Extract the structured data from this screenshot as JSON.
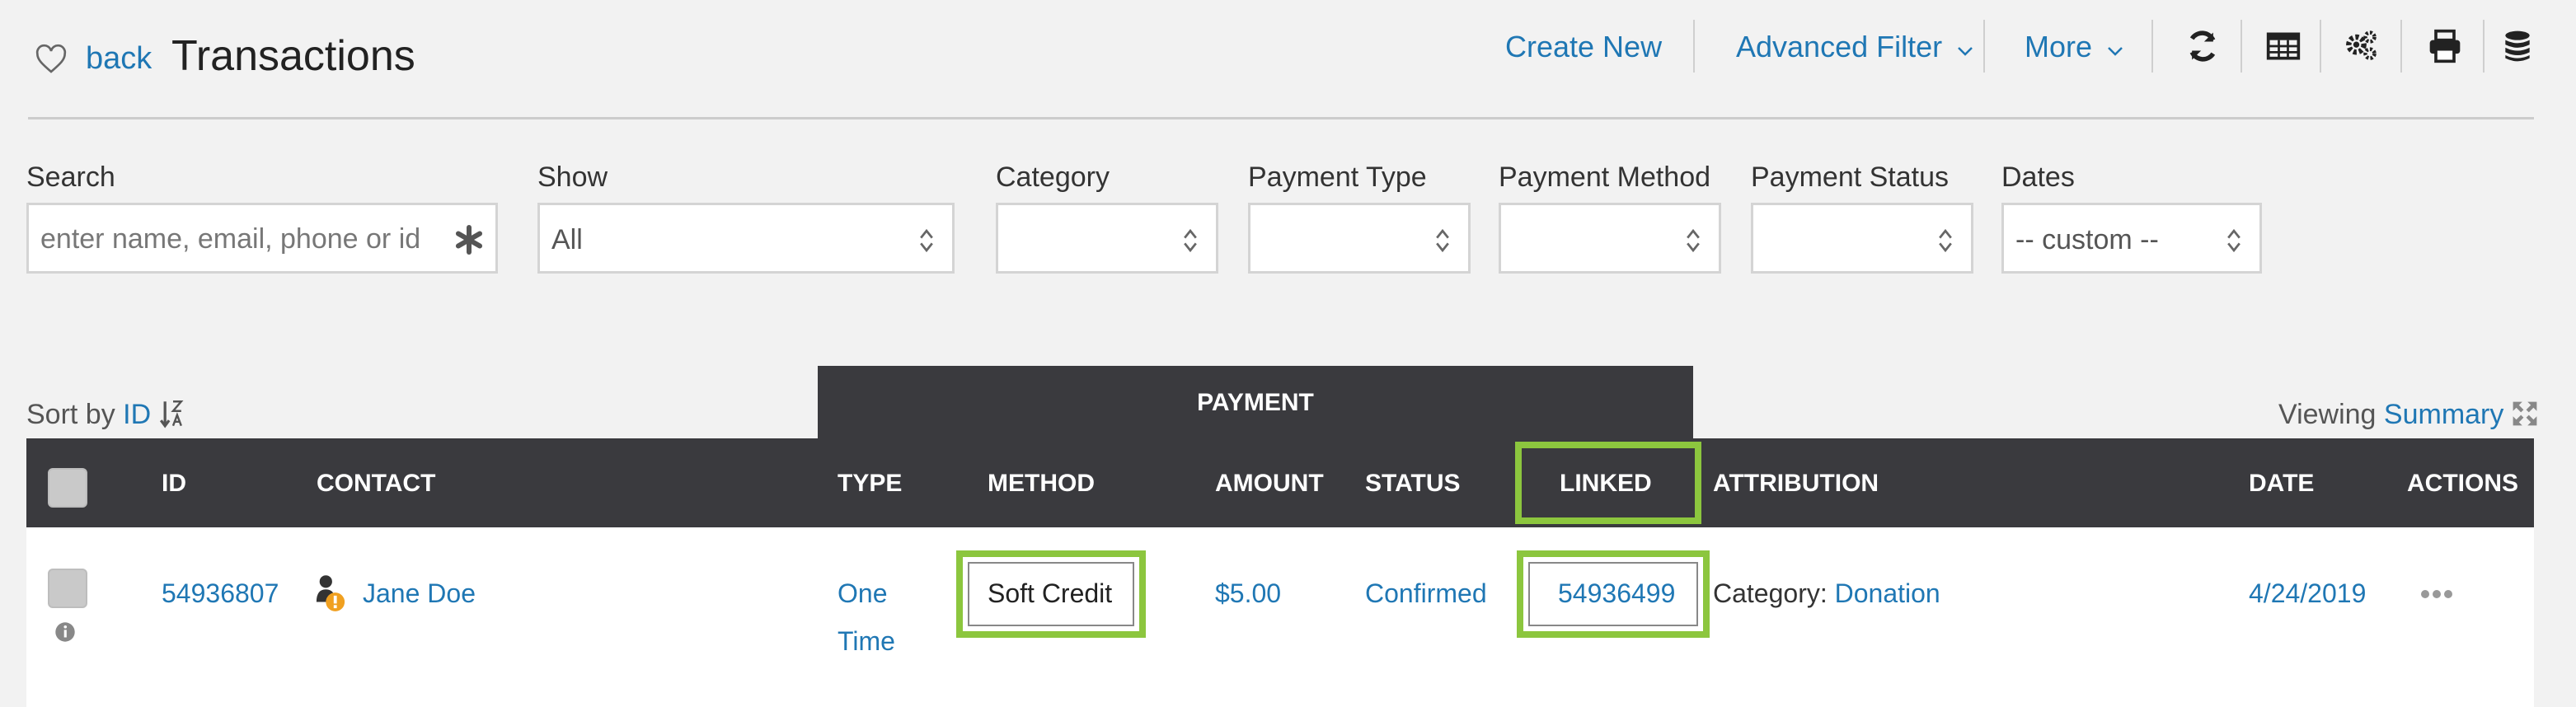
{
  "header": {
    "back_label": "back",
    "title": "Transactions",
    "create_new": "Create New",
    "advanced_filter": "Advanced Filter",
    "more": "More"
  },
  "icons": {
    "favorite": "heart-icon",
    "refresh": "refresh-icon",
    "columns": "table-icon",
    "settings": "gears-icon",
    "print": "print-icon",
    "database": "database-icon"
  },
  "filters": {
    "search_label": "Search",
    "search_placeholder": "enter name, email, phone or id",
    "show_label": "Show",
    "show_value": "All",
    "category_label": "Category",
    "category_value": "",
    "payment_type_label": "Payment Type",
    "payment_type_value": "",
    "payment_method_label": "Payment Method",
    "payment_method_value": "",
    "payment_status_label": "Payment Status",
    "payment_status_value": "",
    "dates_label": "Dates",
    "dates_value": "-- custom --"
  },
  "sort": {
    "prefix": "Sort by",
    "field": "ID"
  },
  "viewing": {
    "prefix": "Viewing",
    "mode": "Summary"
  },
  "table": {
    "group_header": "PAYMENT",
    "columns": {
      "id": "ID",
      "contact": "CONTACT",
      "type": "TYPE",
      "method": "METHOD",
      "amount": "AMOUNT",
      "status": "STATUS",
      "linked": "LINKED",
      "attribution": "ATTRIBUTION",
      "date": "DATE",
      "actions": "ACTIONS"
    },
    "rows": [
      {
        "id": "54936807",
        "contact": "Jane Doe",
        "type_line1": "One",
        "type_line2": "Time",
        "method": "Soft Credit",
        "amount": "$5.00",
        "status": "Confirmed",
        "linked": "54936499",
        "attribution_prefix": "Category:",
        "attribution_value": "Donation",
        "date": "4/24/2019"
      }
    ]
  },
  "colors": {
    "link": "#1f77b4",
    "header_dark": "#3a3a3e",
    "highlight": "#8cc63e",
    "warning": "#f0a020"
  }
}
